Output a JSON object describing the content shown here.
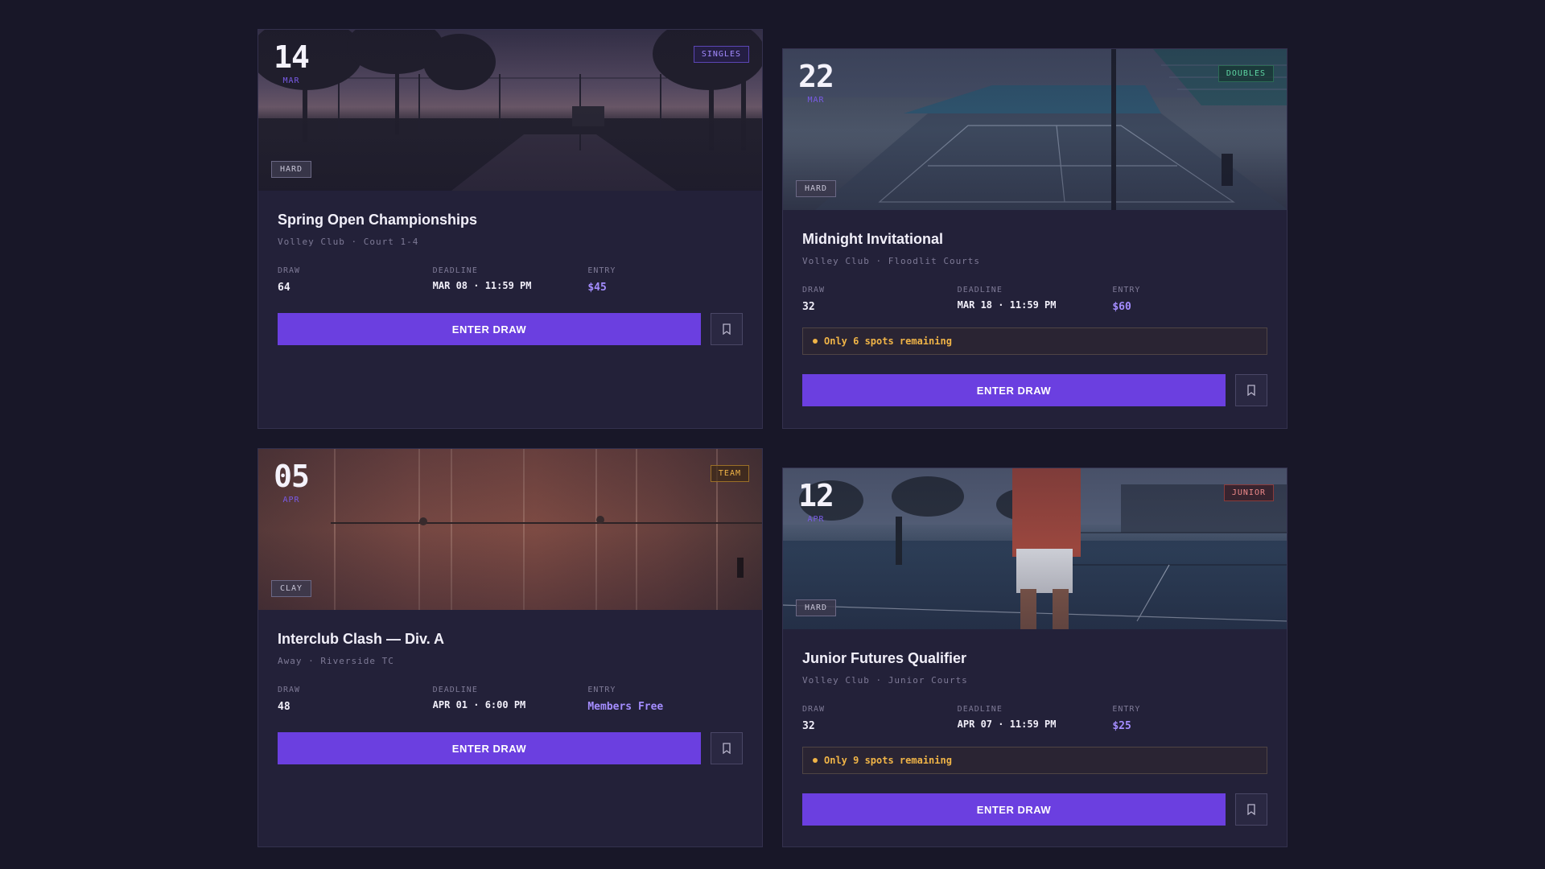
{
  "tournaments": [
    {
      "day": "14",
      "month": "MAR",
      "category": "SINGLES",
      "surface": "HARD",
      "title": "Spring Open Championships",
      "venue": "Volley Club · Court 1-4",
      "draw_label": "DRAW",
      "draw": "64",
      "deadline_label": "DEADLINE",
      "deadline": "MAR 08 · 11:59 PM",
      "entry_label": "ENTRY",
      "entry": "$45",
      "cta": "ENTER DRAW"
    },
    {
      "day": "22",
      "month": "MAR",
      "category": "DOUBLES",
      "surface": "HARD",
      "title": "Midnight Invitational",
      "venue": "Volley Club · Floodlit Courts",
      "draw_label": "DRAW",
      "draw": "32",
      "deadline_label": "DEADLINE",
      "deadline": "MAR 18 · 11:59 PM",
      "entry_label": "ENTRY",
      "entry": "$60",
      "alert": "Only 6 spots remaining",
      "cta": "ENTER DRAW"
    },
    {
      "day": "05",
      "month": "APR",
      "category": "TEAM",
      "surface": "CLAY",
      "title": "Interclub Clash — Div. A",
      "venue": "Away · Riverside TC",
      "draw_label": "DRAW",
      "draw": "48",
      "deadline_label": "DEADLINE",
      "deadline": "APR 01 · 6:00 PM",
      "entry_label": "ENTRY",
      "entry": "Members Free",
      "cta": "ENTER DRAW"
    },
    {
      "day": "12",
      "month": "APR",
      "category": "JUNIOR",
      "surface": "HARD",
      "title": "Junior Futures Qualifier",
      "venue": "Volley Club · Junior Courts",
      "draw_label": "DRAW",
      "draw": "32",
      "deadline_label": "DEADLINE",
      "deadline": "APR 07 · 11:59 PM",
      "entry_label": "ENTRY",
      "entry": "$25",
      "alert": "Only 9 spots remaining",
      "cta": "ENTER DRAW"
    }
  ],
  "icons": {
    "bookmark": "bookmark-icon"
  },
  "colors": {
    "accent": "#6b3fe0",
    "warning": "#f0b447",
    "background": "#181728",
    "card": "#232139"
  }
}
